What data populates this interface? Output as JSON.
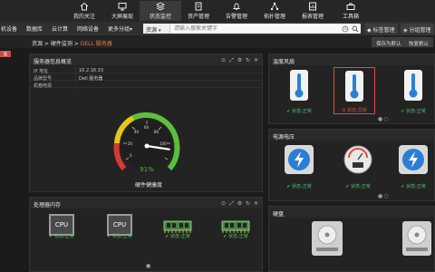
{
  "nav": {
    "items": [
      {
        "label": "我的关注",
        "icon": "home-icon"
      },
      {
        "label": "大屏展现",
        "icon": "monitor-icon"
      },
      {
        "label": "状态监控",
        "icon": "layers-icon"
      },
      {
        "label": "资产管理",
        "icon": "asset-icon"
      },
      {
        "label": "告警管理",
        "icon": "bell-icon"
      },
      {
        "label": "拓扑管理",
        "icon": "topology-icon"
      },
      {
        "label": "报表管理",
        "icon": "report-icon"
      },
      {
        "label": "工具箱",
        "icon": "toolbox-icon"
      }
    ],
    "active_index": 2
  },
  "subbar": {
    "items": [
      "机设备",
      "数据库",
      "云计算",
      "网络设备",
      "更多分组▾"
    ],
    "search_scope": "资源",
    "search_placeholder": "请输入搜索关键字",
    "tag_manage": "标签管理",
    "group_manage": "分组管理"
  },
  "breadcrumb": {
    "home": "资源",
    "sep1": " > ",
    "section": "硬件监测",
    "sep2": " > ",
    "current": "DELL 服务器"
  },
  "actions": {
    "save_default": "保存为默认",
    "restore_default": "恢复默认"
  },
  "rail": {
    "badge": "监"
  },
  "info_panel": {
    "title": "服务器信息概览",
    "rows": [
      {
        "key": "IP 地址",
        "value": "10.2.16.33"
      },
      {
        "key": "品牌型号",
        "value": "Dell 服务器"
      },
      {
        "key": "机箱电源",
        "value": ""
      }
    ],
    "gauge_value": 91,
    "gauge_label": "硬件健康度",
    "gauge_ticks": [
      "20",
      "40",
      "60",
      "80",
      "100"
    ],
    "gauge_zero": "0"
  },
  "temp_panel": {
    "title": "温度风扇",
    "cards": [
      {
        "status": "状态:正常",
        "state": "ok"
      },
      {
        "status": "状态:异常",
        "state": "err"
      },
      {
        "status": "状态:正常",
        "state": "ok"
      }
    ]
  },
  "power_panel": {
    "title": "电源电压",
    "cards": [
      {
        "status": "状态:正常",
        "state": "ok"
      },
      {
        "status": "状态:正常",
        "state": "ok"
      },
      {
        "status": "状态:正常",
        "state": "ok"
      }
    ]
  },
  "cpu_panel": {
    "title": "处理器内存",
    "cards": [
      {
        "label": "CPU",
        "status": "状态:正常"
      },
      {
        "label": "CPU",
        "status": "状态:正常"
      },
      {
        "label": "",
        "status": "状态:正常"
      },
      {
        "label": "",
        "status": "状态:正常"
      }
    ]
  },
  "disk_panel": {
    "title": "硬盘"
  },
  "colors": {
    "accent_orange": "#f07a3c",
    "ok_green": "#4fc36a",
    "err_red": "#e24a3c",
    "thermo_blue": "#2a7fd4"
  }
}
